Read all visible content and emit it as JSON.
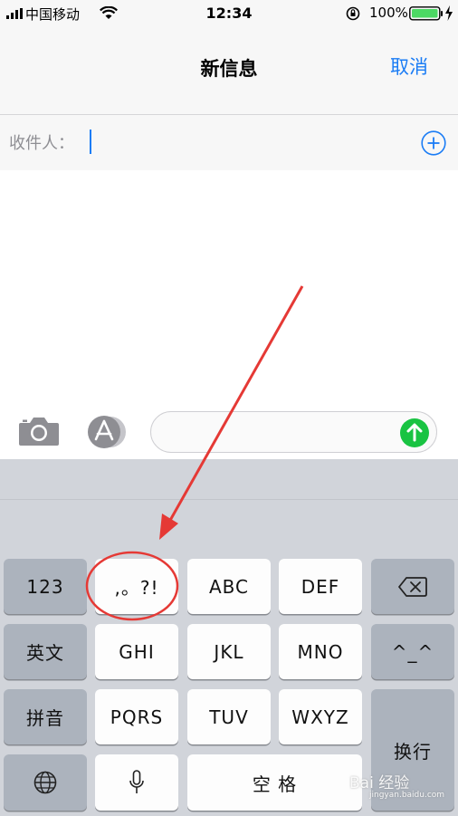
{
  "status_bar": {
    "carrier": "中国移动",
    "time": "12:34",
    "battery": "100%"
  },
  "nav": {
    "title": "新信息",
    "cancel_label": "取消"
  },
  "recipient": {
    "label": "收件人："
  },
  "keyboard": {
    "row1": [
      "123",
      ",。?!",
      "ABC",
      "DEF"
    ],
    "row2": [
      "英文",
      "GHI",
      "JKL",
      "MNO",
      "^_^"
    ],
    "row3": [
      "拼音",
      "PQRS",
      "TUV",
      "WXYZ"
    ],
    "return_label": "换行",
    "space_label": "空 格"
  },
  "icons": [
    "camera-icon",
    "app-store-icon",
    "send-arrow-icon",
    "add-contact-icon",
    "globe-icon",
    "microphone-icon",
    "backspace-icon",
    "wifi-icon",
    "signal-icon",
    "battery-icon"
  ],
  "colors": {
    "accent": "#1a7cf5",
    "send": "#19c342",
    "annotation": "#e53935"
  },
  "watermark": {
    "brand": "Bai 经验",
    "url": "jingyan.baidu.com"
  }
}
